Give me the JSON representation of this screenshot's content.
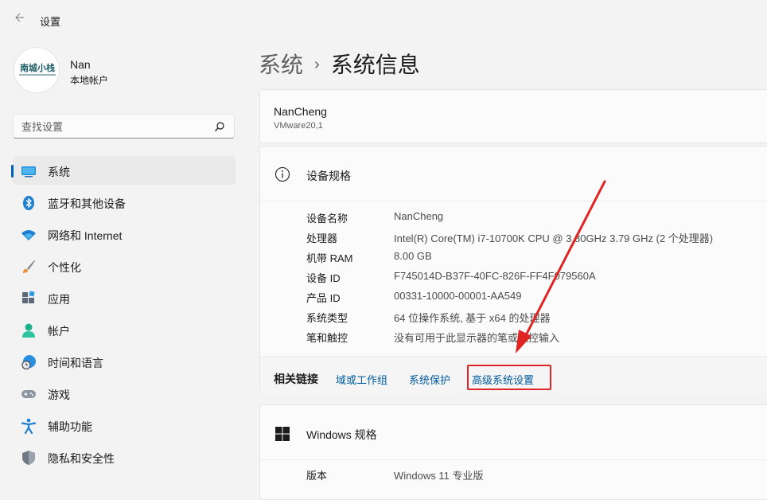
{
  "app": {
    "title": "设置",
    "back_icon": "back-arrow-icon"
  },
  "user": {
    "name": "Nan",
    "account_type": "本地帐户",
    "avatar_text": "南城小栈"
  },
  "search": {
    "placeholder": "查找设置",
    "icon": "search-icon"
  },
  "nav": {
    "items": [
      {
        "label": "系统",
        "icon": "display-icon",
        "active": true
      },
      {
        "label": "蓝牙和其他设备",
        "icon": "bluetooth-icon"
      },
      {
        "label": "网络和 Internet",
        "icon": "wifi-icon"
      },
      {
        "label": "个性化",
        "icon": "brush-icon"
      },
      {
        "label": "应用",
        "icon": "apps-icon"
      },
      {
        "label": "帐户",
        "icon": "person-icon"
      },
      {
        "label": "时间和语言",
        "icon": "globe-clock-icon"
      },
      {
        "label": "游戏",
        "icon": "gamepad-icon"
      },
      {
        "label": "辅助功能",
        "icon": "accessibility-icon"
      },
      {
        "label": "隐私和安全性",
        "icon": "shield-icon"
      }
    ]
  },
  "breadcrumb": {
    "parent": "系统",
    "separator": "›",
    "current": "系统信息"
  },
  "device": {
    "name": "NanCheng",
    "model": "VMware20,1"
  },
  "specs": {
    "title": "设备规格",
    "rows": [
      {
        "key": "设备名称",
        "value": "NanCheng"
      },
      {
        "key": "处理器",
        "value": "Intel(R) Core(TM) i7-10700K CPU @ 3.80GHz   3.79 GHz  (2 个处理器)"
      },
      {
        "key": "机带 RAM",
        "value": "8.00 GB"
      },
      {
        "key": "设备 ID",
        "value": "F745014D-B37F-40FC-826F-FF4F079560A"
      },
      {
        "key": "产品 ID",
        "value": "00331-10000-00001-AA549"
      },
      {
        "key": "系统类型",
        "value": "64 位操作系统, 基于 x64 的处理器"
      },
      {
        "key": "笔和触控",
        "value": "没有可用于此显示器的笔或触控输入"
      }
    ]
  },
  "related_links": {
    "label": "相关链接",
    "links": [
      "域或工作组",
      "系统保护",
      "高级系统设置"
    ]
  },
  "windows_specs": {
    "title": "Windows 规格",
    "rows": [
      {
        "key": "版本",
        "value": "Windows 11 专业版"
      }
    ]
  },
  "colors": {
    "accent": "#005fb8",
    "link": "#005a9e",
    "highlight": "#e02424"
  }
}
